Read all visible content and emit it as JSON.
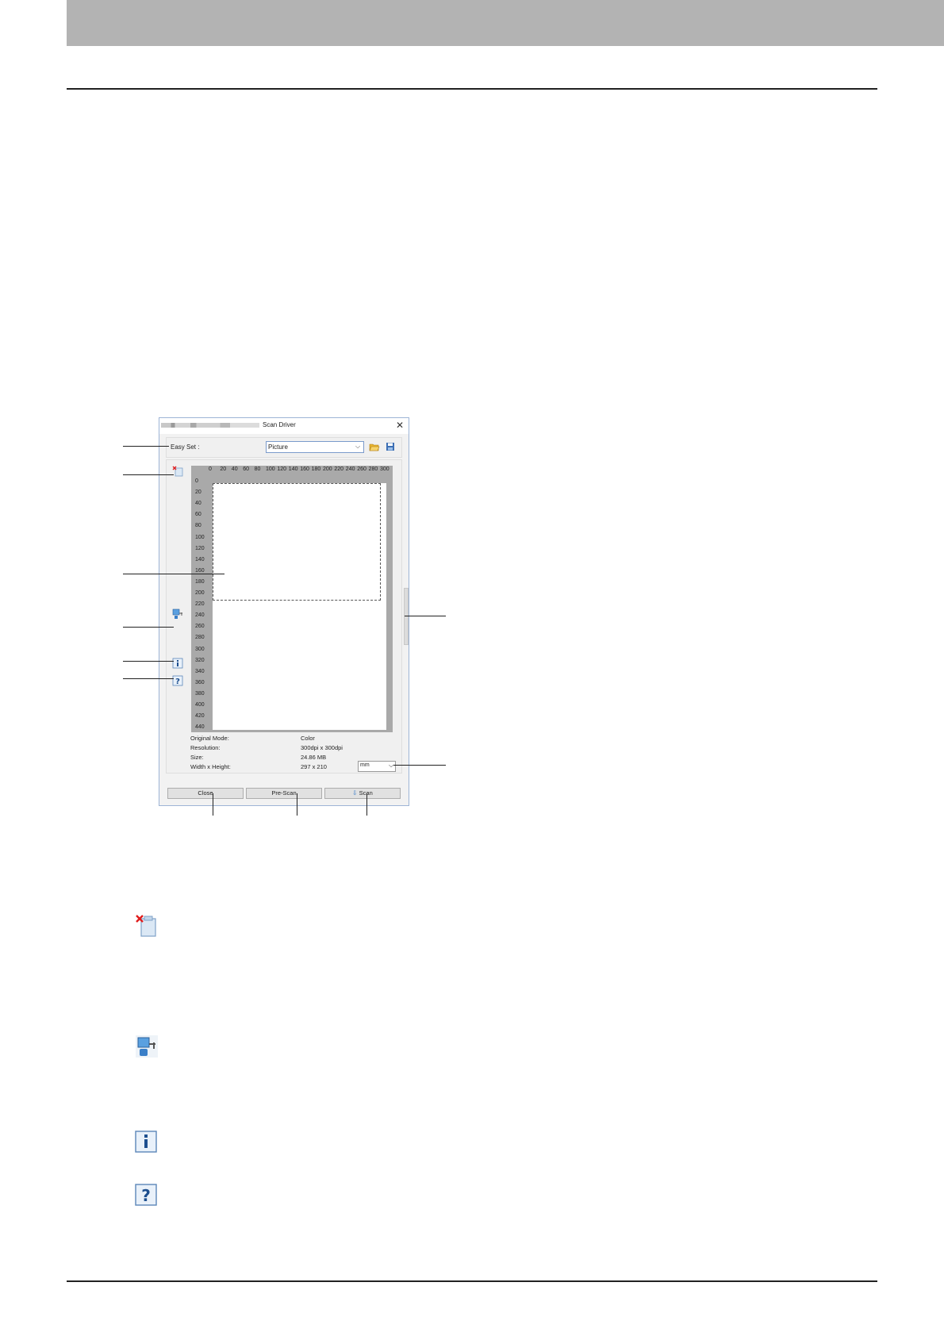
{
  "dialog": {
    "title": "Scan Driver",
    "easy_set_label": "Easy Set :",
    "easy_set_value": "Picture",
    "ruler_x": [
      "0",
      "20",
      "40",
      "60",
      "80",
      "100",
      "120",
      "140",
      "160",
      "180",
      "200",
      "220",
      "240",
      "260",
      "280",
      "300"
    ],
    "ruler_y": [
      "0",
      "20",
      "40",
      "60",
      "80",
      "100",
      "120",
      "140",
      "160",
      "180",
      "200",
      "220",
      "240",
      "260",
      "280",
      "300",
      "320",
      "340",
      "360",
      "380",
      "400",
      "420",
      "440"
    ],
    "info": [
      {
        "label": "Original Mode:",
        "value": "Color"
      },
      {
        "label": "Resolution:",
        "value": "300dpi x 300dpi"
      },
      {
        "label": "Size:",
        "value": "24.86 MB"
      },
      {
        "label": "Width x Height:",
        "value": "297 x 210"
      }
    ],
    "unit_value": "mm",
    "buttons": {
      "close": "Close",
      "prescan": "Pre-Scan",
      "scan": "Scan"
    }
  },
  "icons": {
    "clear": "clear-preview-icon",
    "connection": "connection-icon",
    "info": "info-icon",
    "help": "help-icon",
    "open": "folder-open-icon",
    "save": "save-icon"
  }
}
